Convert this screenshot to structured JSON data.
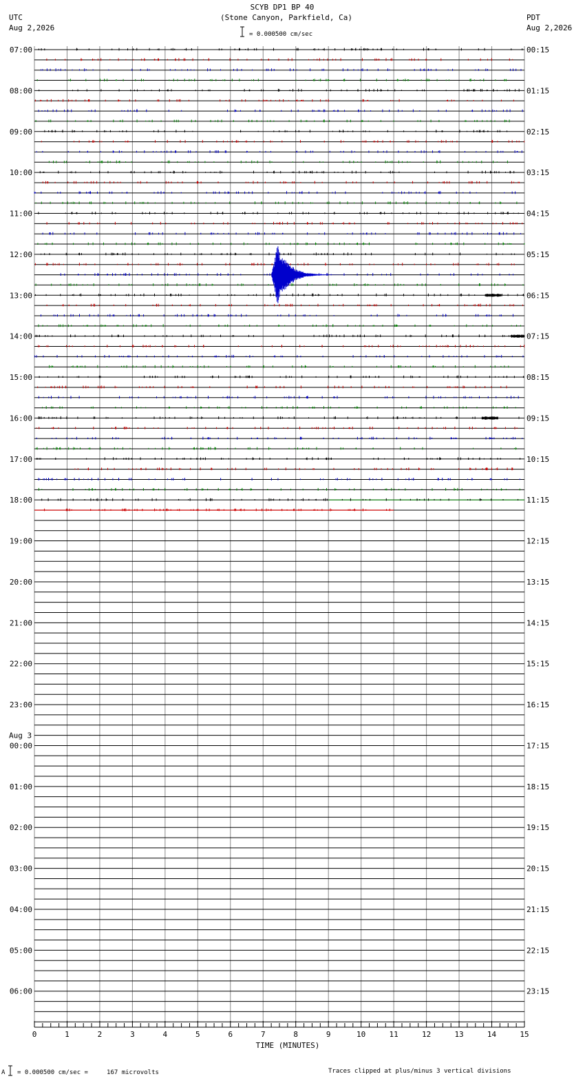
{
  "header": {
    "title": "SCYB DP1 BP 40",
    "subtitle": "(Stone Canyon, Parkfield, Ca)",
    "scale_label": "= 0.000500 cm/sec",
    "left_tz": "UTC",
    "left_date": "Aug 2,2026",
    "right_tz": "PDT",
    "right_date": "Aug 2,2026"
  },
  "footer": {
    "scale_note": "= 0.000500 cm/sec =     167 microvolts",
    "scale_marker": "A",
    "clip_note": "Traces clipped at plus/minus 3 vertical divisions"
  },
  "chart_data": {
    "type": "line",
    "description_type": "helicorder",
    "xlabel": "TIME (MINUTES)",
    "xlim": [
      0,
      15
    ],
    "x_ticks": [
      "0",
      "1",
      "2",
      "3",
      "4",
      "5",
      "6",
      "7",
      "8",
      "9",
      "10",
      "11",
      "12",
      "13",
      "14",
      "15"
    ],
    "rows_per_hour": 4,
    "row_minutes": 15,
    "total_rows": 96,
    "left_labels": [
      "07:00",
      "08:00",
      "09:00",
      "10:00",
      "11:00",
      "12:00",
      "13:00",
      "14:00",
      "15:00",
      "16:00",
      "17:00",
      "18:00",
      "19:00",
      "20:00",
      "21:00",
      "22:00",
      "23:00",
      "00:00",
      "01:00",
      "02:00",
      "03:00",
      "04:00",
      "05:00",
      "06:00"
    ],
    "day_change_label": "Aug 3",
    "day_change_hour_index": 17,
    "right_labels": [
      "00:15",
      "01:15",
      "02:15",
      "03:15",
      "04:15",
      "05:15",
      "06:15",
      "07:15",
      "08:15",
      "09:15",
      "10:15",
      "11:15",
      "12:15",
      "13:15",
      "14:15",
      "15:15",
      "16:15",
      "17:15",
      "18:15",
      "19:15",
      "20:15",
      "21:15",
      "22:15",
      "23:15"
    ],
    "trace_colors": [
      "#000000",
      "#cc0000",
      "#0000cc",
      "#008800"
    ],
    "data_rows": 46,
    "last_row_end_minute": 11,
    "events": [
      {
        "row": 22,
        "start_minute": 7.25,
        "peak_minute": 7.45,
        "end_minute": 10.0,
        "amplitude_divisions": 3,
        "clipped": true,
        "color": "#0000cc"
      },
      {
        "row": 24,
        "start_minute": 13.8,
        "end_minute": 14.3,
        "amplitude_divisions": 0.15,
        "color": "#000000"
      },
      {
        "row": 28,
        "start_minute": 14.6,
        "end_minute": 15.0,
        "amplitude_divisions": 0.15,
        "color": "#000000"
      },
      {
        "row": 36,
        "start_minute": 13.7,
        "end_minute": 14.2,
        "amplitude_divisions": 0.15,
        "color": "#000000"
      }
    ]
  }
}
